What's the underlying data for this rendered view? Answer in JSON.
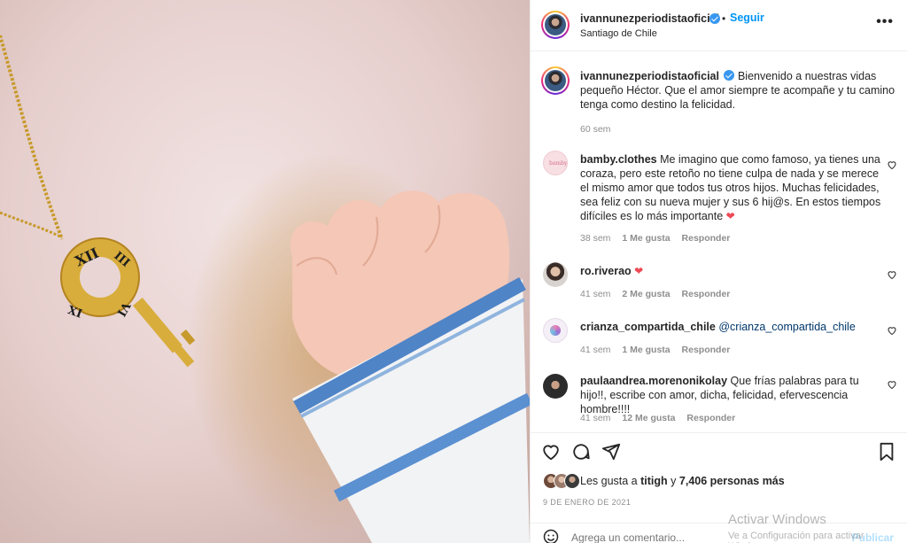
{
  "post": {
    "username": "ivannunezperiodistaoficial",
    "follow_label": "Seguir",
    "location": "Santiago de Chile",
    "more_icon": "more-horizontal-icon",
    "caption": "Bienvenido a nuestras vidas pequeño Héctor. Que el amor siempre te acompañe y tu camino tenga como destino la felicidad.",
    "caption_time": "60 sem",
    "likes_prefix": "Les gusta a",
    "likes_user": "titigh",
    "likes_joiner": "y",
    "likes_count": "7,406 personas más",
    "date": "9 DE ENERO DE 2021"
  },
  "comments": [
    {
      "username": "bamby.clothes",
      "text": "Me imagino que como famoso, ya tienes una coraza, pero este retoño no tiene culpa de nada y se merece el mismo amor que todos tus otros hijos. Muchas felicidades, sea feliz con su nueva mujer y sus 6 hij@s. En estos tiempos difíciles es lo más importante",
      "time": "38 sem",
      "likes": "1 Me gusta",
      "reply": "Responder"
    },
    {
      "username": "ro.riverao",
      "text": "",
      "time": "41 sem",
      "likes": "2 Me gusta",
      "reply": "Responder"
    },
    {
      "username": "crianza_compartida_chile",
      "text": "@crianza_compartida_chile",
      "time": "41 sem",
      "likes": "1 Me gusta",
      "reply": "Responder"
    },
    {
      "username": "paulaandrea.morenonikolay",
      "text": "Que frías palabras para tu hijo!!, escribe con amor, dicha, felicidad, efervescencia hombre!!!!",
      "time": "41 sem",
      "likes": "12 Me gusta",
      "reply": "Responder"
    }
  ],
  "composer": {
    "placeholder": "Agrega un comentario...",
    "post_label": "Publicar"
  },
  "watermark": {
    "title": "Activar Windows",
    "subtitle": "Ve a Configuración para activar Windows."
  },
  "icons": [
    "heart-icon",
    "comment-icon",
    "share-icon",
    "bookmark-icon",
    "emoji-icon",
    "verified-badge-icon"
  ],
  "colors": {
    "link_blue": "#0095f6",
    "verified_blue": "#3897f0",
    "heart_red": "#ed4956",
    "meta_gray": "#8e8e8e"
  }
}
